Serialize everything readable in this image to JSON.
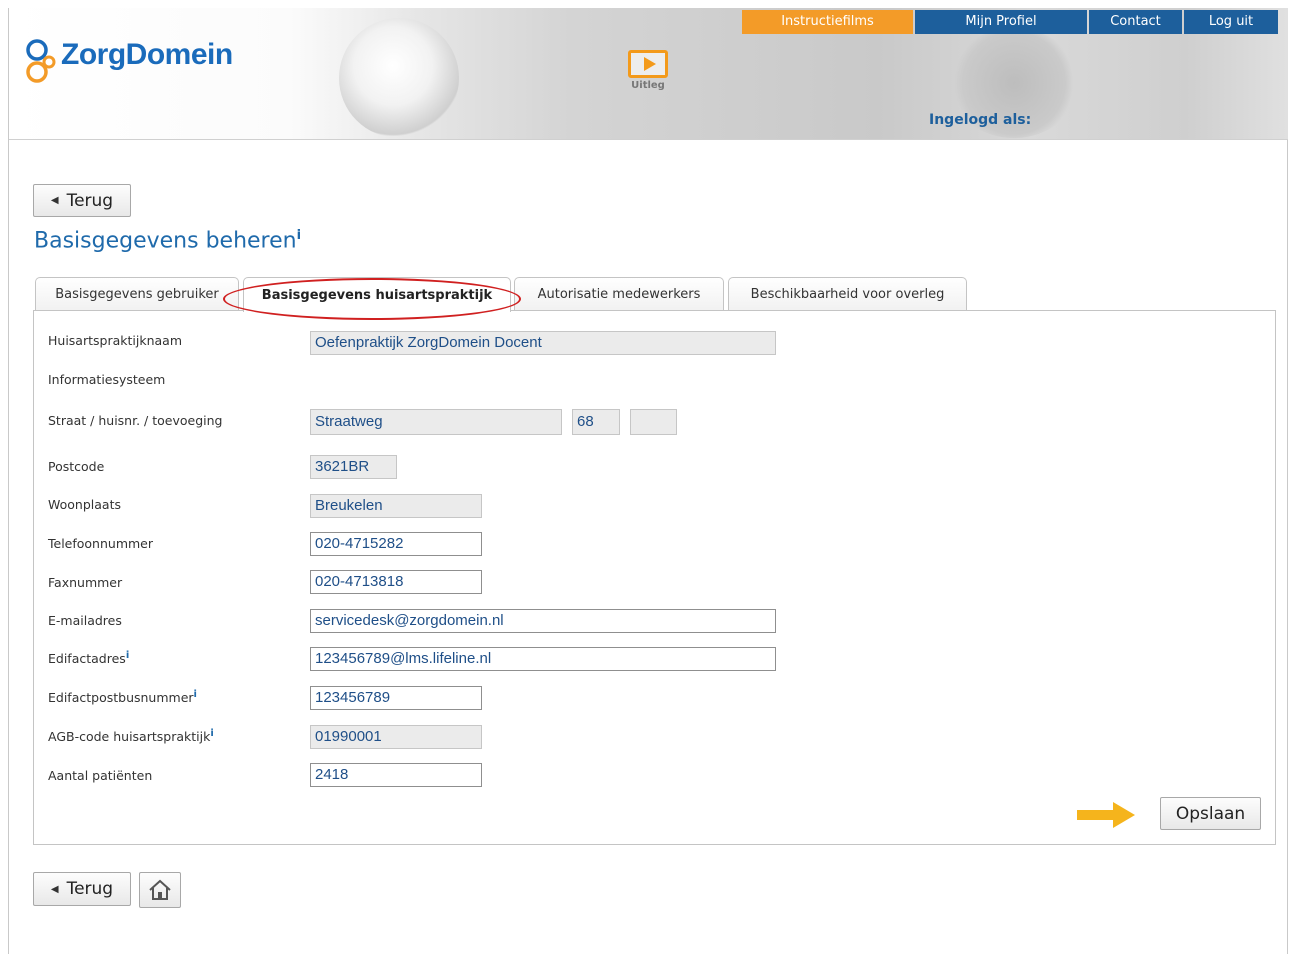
{
  "brand": {
    "name": "ZorgDomein",
    "video_label": "Uitleg"
  },
  "topnav": {
    "instructiefilms": "Instructiefilms",
    "mijn_profiel": "Mijn Profiel",
    "contact": "Contact",
    "log_uit": "Log uit"
  },
  "header": {
    "logged_in_label": "Ingelogd als:"
  },
  "back_label": "Terug",
  "page_title": "Basisgegevens beheren",
  "info_marker": "i",
  "tabs": [
    {
      "label": "Basisgegevens gebruiker",
      "active": false
    },
    {
      "label": "Basisgegevens huisartspraktijk",
      "active": true
    },
    {
      "label": "Autorisatie medewerkers",
      "active": false
    },
    {
      "label": "Beschikbaarheid voor overleg",
      "active": false
    }
  ],
  "form": {
    "praktijknaam": {
      "label": "Huisartspraktijknaam",
      "value": "Oefenpraktijk ZorgDomein Docent"
    },
    "informatiesysteem": {
      "label": "Informatiesysteem"
    },
    "straat": {
      "label": "Straat / huisnr. / toevoeging",
      "street": "Straatweg",
      "number": "68",
      "addition": ""
    },
    "postcode": {
      "label": "Postcode",
      "value": "3621BR"
    },
    "woonplaats": {
      "label": "Woonplaats",
      "value": "Breukelen"
    },
    "telefoon": {
      "label": "Telefoonnummer",
      "value": "020-4715282"
    },
    "fax": {
      "label": "Faxnummer",
      "value": "020-4713818"
    },
    "email": {
      "label": "E-mailadres",
      "value": "servicedesk@zorgdomein.nl"
    },
    "edifact": {
      "label": "Edifactadres",
      "value": "123456789@lms.lifeline.nl"
    },
    "edifactpostbus": {
      "label": "Edifactpostbusnummer",
      "value": "123456789"
    },
    "agb": {
      "label": "AGB-code huisartspraktijk",
      "value": "01990001"
    },
    "patienten": {
      "label": "Aantal patiënten",
      "value": "2418"
    }
  },
  "save_label": "Opslaan",
  "colors": {
    "brand_blue": "#1d5f9c",
    "accent_orange": "#f39b28",
    "highlight_red": "#d02020",
    "arrow_yellow": "#f5b41c"
  }
}
